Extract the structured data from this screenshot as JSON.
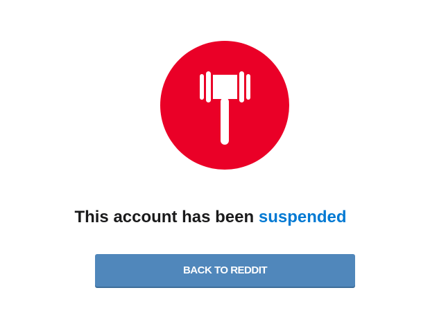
{
  "icon": {
    "name": "gavel-icon",
    "background_color": "#ea0027",
    "color": "#ffffff"
  },
  "message": {
    "prefix": "This account has been",
    "highlight": "suspended",
    "text_color": "#1a1a1b",
    "highlight_color": "#0079d3"
  },
  "button": {
    "label": "BACK TO REDDIT",
    "background_color": "#5087bb"
  }
}
